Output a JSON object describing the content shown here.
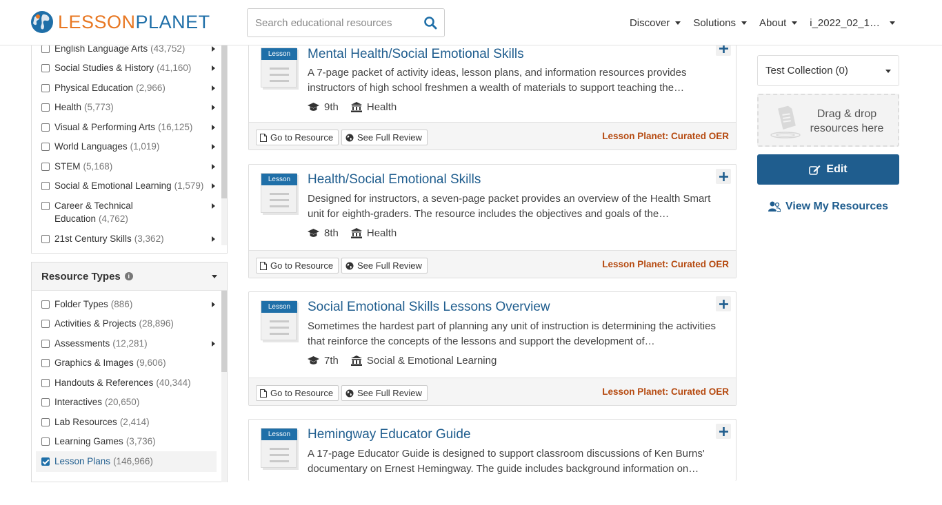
{
  "header": {
    "logo_part1": "LESSON",
    "logo_part2": "PLANET",
    "search_placeholder": "Search educational resources",
    "nav": [
      "Discover",
      "Solutions",
      "About",
      "i_2022_02_1…"
    ]
  },
  "subjects": [
    {
      "label": "English Language Arts",
      "count": "(43,752)",
      "expand": true
    },
    {
      "label": "Social Studies & History",
      "count": "(41,160)",
      "expand": true
    },
    {
      "label": "Physical Education",
      "count": "(2,966)",
      "expand": true
    },
    {
      "label": "Health",
      "count": "(5,773)",
      "expand": true
    },
    {
      "label": "Visual & Performing Arts",
      "count": "(16,125)",
      "expand": true
    },
    {
      "label": "World Languages",
      "count": "(1,019)",
      "expand": true
    },
    {
      "label": "STEM",
      "count": "(5,168)",
      "expand": true
    },
    {
      "label": "Social & Emotional Learning",
      "count": "(1,579)",
      "expand": true
    },
    {
      "label": "Career & Technical Education",
      "count": "(4,762)",
      "expand": true
    },
    {
      "label": "21st Century Skills",
      "count": "(3,362)",
      "expand": true
    }
  ],
  "resource_types": {
    "title": "Resource Types",
    "items": [
      {
        "label": "Folder Types",
        "count": "(886)",
        "expand": true,
        "checked": false
      },
      {
        "label": "Activities & Projects",
        "count": "(28,896)",
        "expand": false,
        "checked": false
      },
      {
        "label": "Assessments",
        "count": "(12,281)",
        "expand": true,
        "checked": false
      },
      {
        "label": "Graphics & Images",
        "count": "(9,606)",
        "expand": false,
        "checked": false
      },
      {
        "label": "Handouts & References",
        "count": "(40,344)",
        "expand": false,
        "checked": false
      },
      {
        "label": "Interactives",
        "count": "(20,650)",
        "expand": false,
        "checked": false
      },
      {
        "label": "Lab Resources",
        "count": "(2,414)",
        "expand": false,
        "checked": false
      },
      {
        "label": "Learning Games",
        "count": "(3,736)",
        "expand": false,
        "checked": false
      },
      {
        "label": "Lesson Plans",
        "count": "(146,966)",
        "expand": false,
        "checked": true
      }
    ]
  },
  "cards": [
    {
      "type_label": "Lesson",
      "title": "Mental Health/Social Emotional Skills",
      "desc": "A 7-page packet of activity ideas, lesson plans, and information resources provides instructors of high school freshmen a wealth of materials to support teaching the…",
      "grade": "9th",
      "subject": "Health",
      "go_label": "Go to Resource",
      "review_label": "See Full Review",
      "oer_label": "Lesson Planet: Curated OER"
    },
    {
      "type_label": "Lesson",
      "title": "Health/Social Emotional Skills",
      "desc": "Designed for instructors, a seven-page packet provides an overview of the Health Smart unit for eighth-graders. The resource includes the objectives and goals of the…",
      "grade": "8th",
      "subject": "Health",
      "go_label": "Go to Resource",
      "review_label": "See Full Review",
      "oer_label": "Lesson Planet: Curated OER"
    },
    {
      "type_label": "Lesson",
      "title": "Social Emotional Skills Lessons Overview",
      "desc": "Sometimes the hardest part of planning any unit of instruction is determining the activities that reinforce the concepts of the lessons and support the development of…",
      "grade": "7th",
      "subject": "Social & Emotional Learning",
      "go_label": "Go to Resource",
      "review_label": "See Full Review",
      "oer_label": "Lesson Planet: Curated OER"
    },
    {
      "type_label": "Lesson",
      "title": "Hemingway Educator Guide",
      "desc": "A 17-page Educator Guide is designed to support classroom discussions of Ken Burns' documentary on Ernest Hemingway. The guide includes background information on…",
      "grade": "",
      "subject": "",
      "go_label": "",
      "review_label": "",
      "oer_label": ""
    }
  ],
  "right_panel": {
    "collection_label": "Test Collection",
    "collection_count": "(0)",
    "dropzone_text": "Drag & drop resources here",
    "edit_label": "Edit",
    "view_label": "View My Resources"
  },
  "colors": {
    "brand_orange": "#e87722",
    "brand_blue": "#1f5d8e",
    "oer_red": "#b5490f"
  }
}
